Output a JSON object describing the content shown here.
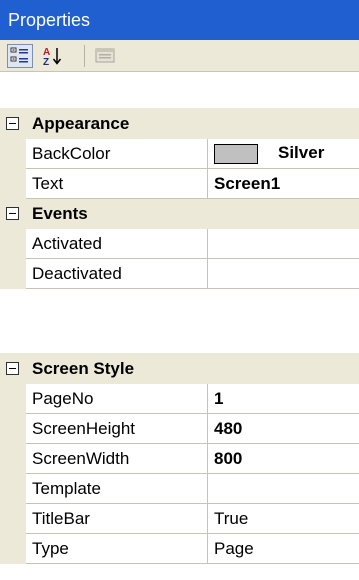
{
  "window": {
    "title": "Properties"
  },
  "toolbar": {
    "categorized_icon": "categorized-icon",
    "alphabetical_icon": "alphabetical-sort-icon",
    "property_pages_icon": "property-pages-icon",
    "alpha_glyph_top": "A",
    "alpha_glyph_bottom": "Z",
    "alpha_arrow": "↓"
  },
  "grid1": {
    "appearance": {
      "label": "Appearance",
      "backcolor": {
        "name": "BackColor",
        "value": "Silver",
        "swatch_color": "#c0c0c0"
      },
      "text": {
        "name": "Text",
        "value": "Screen1"
      }
    },
    "events": {
      "label": "Events",
      "activated": {
        "name": "Activated",
        "value": ""
      },
      "deactivated": {
        "name": "Deactivated",
        "value": ""
      }
    }
  },
  "grid2": {
    "screen_style": {
      "label": "Screen Style",
      "pageno": {
        "name": "PageNo",
        "value": "1"
      },
      "screenheight": {
        "name": "ScreenHeight",
        "value": "480"
      },
      "screenwidth": {
        "name": "ScreenWidth",
        "value": "800"
      },
      "template": {
        "name": "Template",
        "value": ""
      },
      "titlebar": {
        "name": "TitleBar",
        "value": "True"
      },
      "type": {
        "name": "Type",
        "value": "Page"
      }
    }
  },
  "colors": {
    "title_bar": "#1f5fd0",
    "panel": "#ece9d8",
    "grid_line": "#c8c4b4"
  }
}
